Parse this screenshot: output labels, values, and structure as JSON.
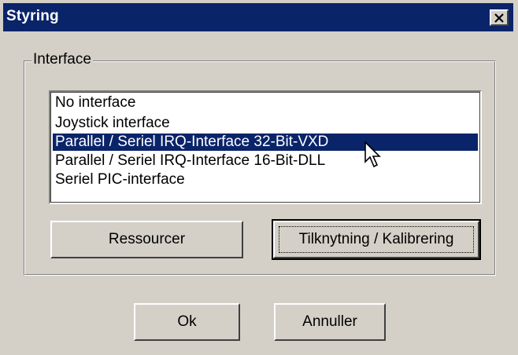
{
  "window": {
    "title": "Styring",
    "close_symbol": "✕"
  },
  "interface_group": {
    "label": "Interface",
    "items": [
      {
        "label": "No interface",
        "selected": false
      },
      {
        "label": "Joystick interface",
        "selected": false
      },
      {
        "label": "Parallel / Seriel IRQ-Interface 32-Bit-VXD",
        "selected": true
      },
      {
        "label": "Parallel / Seriel IRQ-Interface 16-Bit-DLL",
        "selected": false
      },
      {
        "label": "Seriel PIC-interface",
        "selected": false
      }
    ],
    "resources_button": "Ressourcer",
    "connect_button": "Tilknytning / Kalibrering"
  },
  "footer": {
    "ok_button": "Ok",
    "cancel_button": "Annuller"
  },
  "colors": {
    "titlebar": "#0a246a",
    "face": "#d4d0c8",
    "selection": "#0a246a"
  }
}
